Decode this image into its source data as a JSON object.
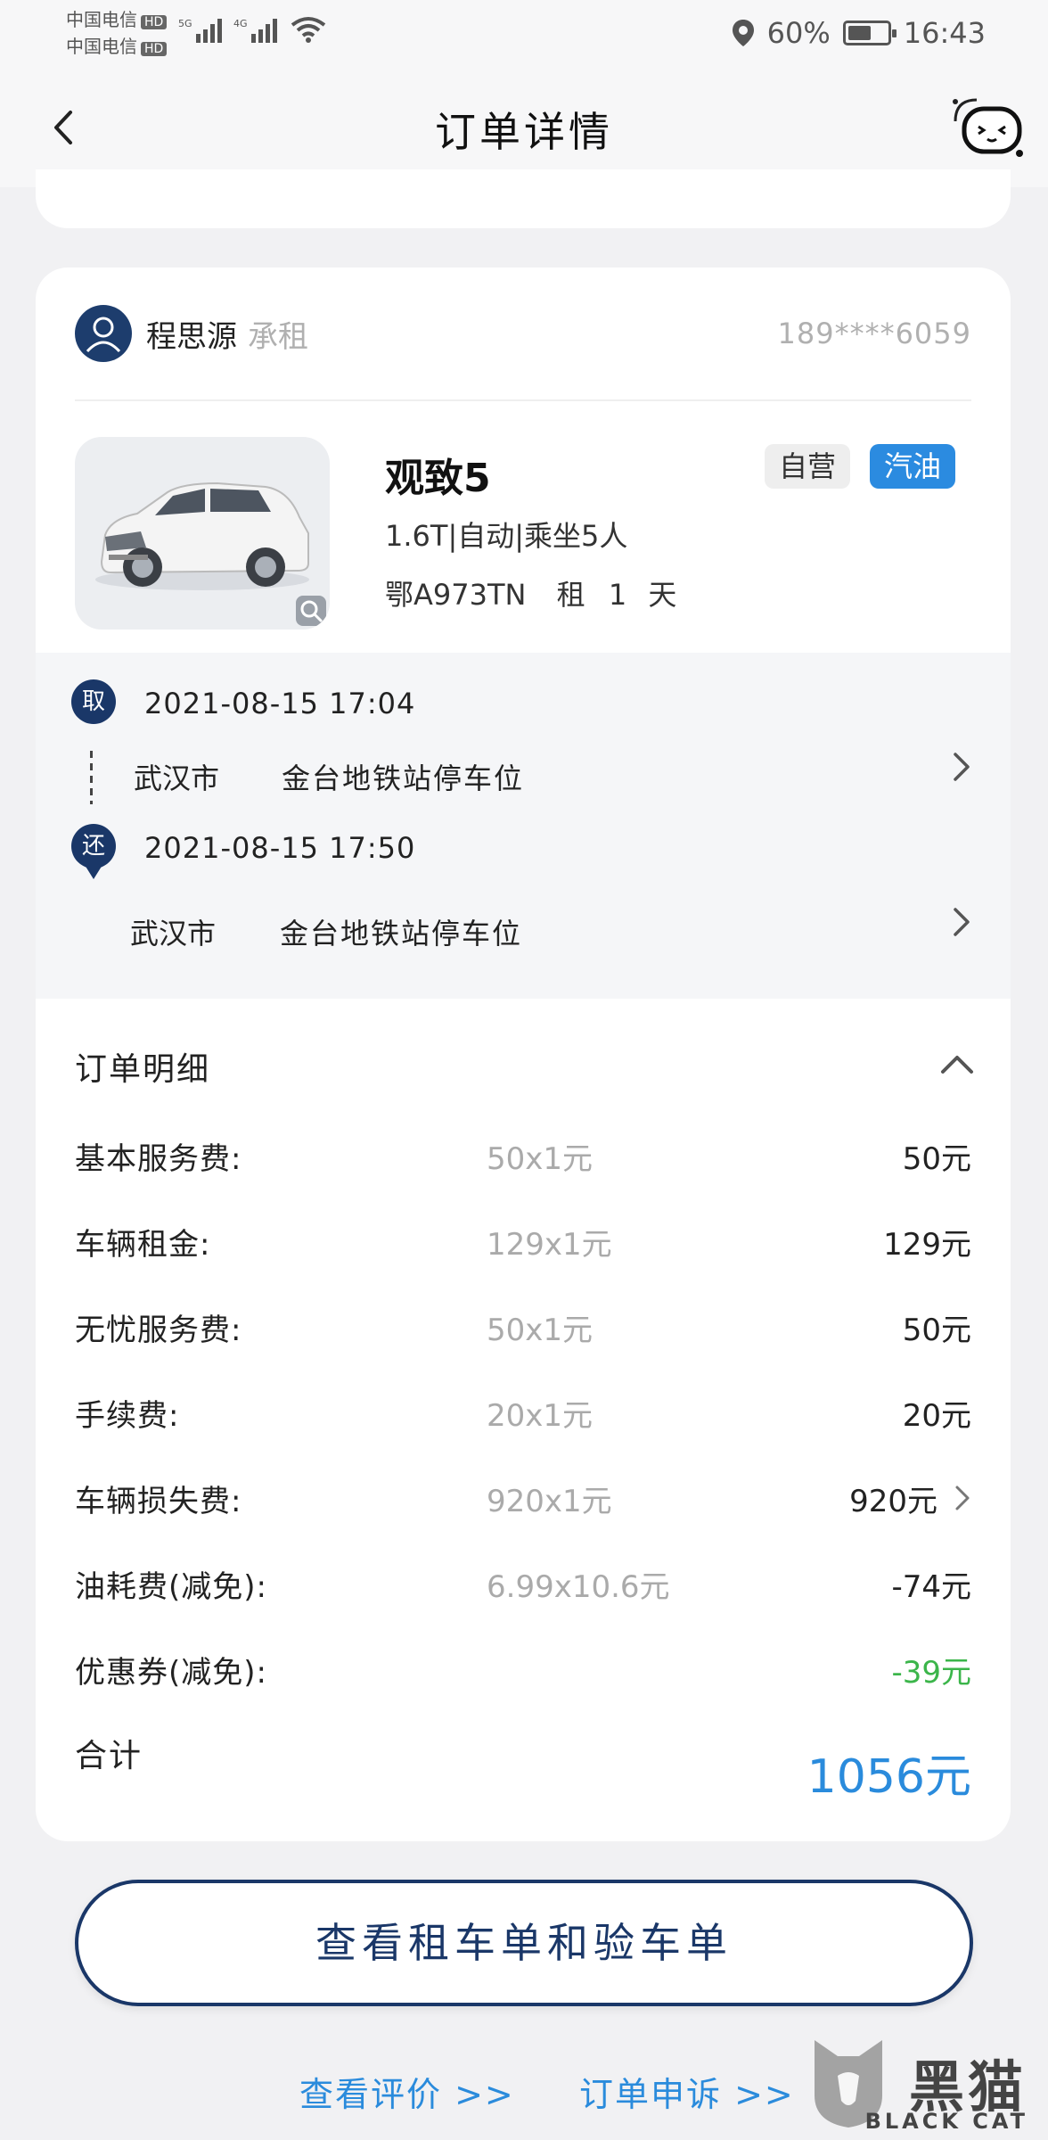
{
  "status_bar": {
    "carrier1": "中国电信",
    "carrier2": "中国电信",
    "hd": "HD",
    "net1": "5G",
    "net2": "4G",
    "battery_text": "60%",
    "battery_level": 0.6,
    "time": "16:43"
  },
  "nav": {
    "title": "订单详情",
    "back_icon": "chevron-left-icon",
    "service_icon": "customer-service-icon"
  },
  "renter": {
    "name": "程思源",
    "role": "承租",
    "phone": "189****6059"
  },
  "car": {
    "name": "观致5",
    "tag_self": "自营",
    "tag_fuel": "汽油",
    "spec": "1.6T|自动|乘坐5人",
    "plate": "鄂A973TN",
    "rent_label": "租",
    "rent_days": "1",
    "rent_unit": "天"
  },
  "route": {
    "pickup_badge": "取",
    "pickup_time": "2021-08-15 17:04",
    "pickup_city": "武汉市",
    "pickup_place": "金台地铁站停车位",
    "return_badge": "还",
    "return_time": "2021-08-15 17:50",
    "return_city": "武汉市",
    "return_place": "金台地铁站停车位"
  },
  "detail": {
    "title": "订单明细",
    "fees": [
      {
        "label": "基本服务费:",
        "formula": "50x1元",
        "amount": "50元"
      },
      {
        "label": "车辆租金:",
        "formula": "129x1元",
        "amount": "129元"
      },
      {
        "label": "无忧服务费:",
        "formula": "50x1元",
        "amount": "50元"
      },
      {
        "label": "手续费:",
        "formula": "20x1元",
        "amount": "20元"
      },
      {
        "label": "车辆损失费:",
        "formula": "920x1元",
        "amount": "920元"
      },
      {
        "label": "油耗费(减免):",
        "formula": "6.99x10.6元",
        "amount": "-74元"
      },
      {
        "label": "优惠券(减免):",
        "formula": "",
        "amount": "-39元"
      }
    ],
    "total_label": "合计",
    "total_amount": "1056元"
  },
  "actions": {
    "main_button": "查看租车单和验车单",
    "view_review": "查看评价 >>",
    "complaint": "订单申诉 >>"
  },
  "watermark": {
    "text": "黑猫",
    "sub": "BLACK CAT"
  },
  "colors": {
    "brand_navy": "#1a3768",
    "accent_blue": "#2a8bdc",
    "discount_green": "#3bb54a"
  }
}
